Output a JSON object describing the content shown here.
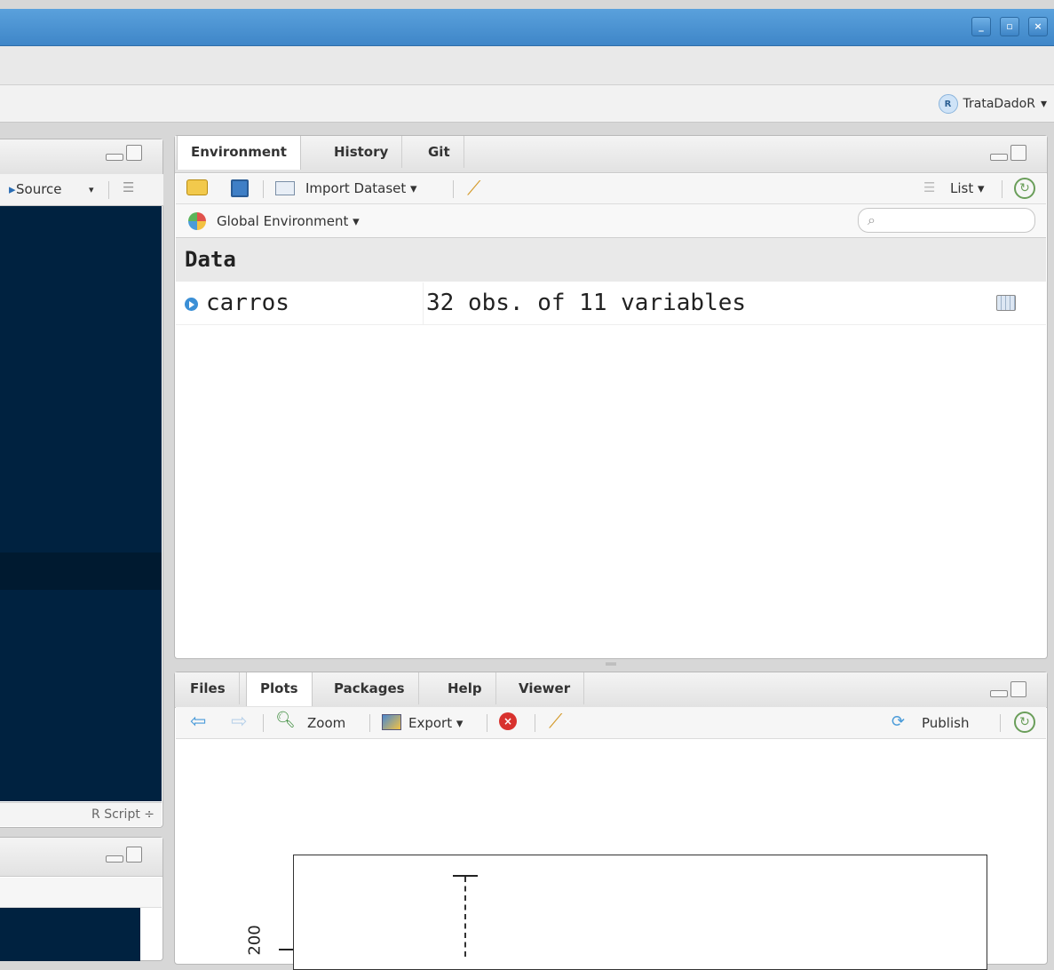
{
  "window": {
    "buttons": {
      "minimize": "_",
      "restore": "▫",
      "close": "×"
    }
  },
  "project": {
    "name": "TrataDadoR",
    "caret": "▾",
    "icon": "R"
  },
  "source_pane": {
    "toolbar": {
      "source_label": "Source",
      "caret": "▾"
    },
    "status": {
      "file_type": "R Script ÷"
    }
  },
  "env_pane": {
    "tabs": [
      "Environment",
      "History",
      "Git"
    ],
    "toolbar": {
      "import_label": "Import Dataset ▾",
      "view_mode": "List ▾"
    },
    "scope": {
      "label": "Global Environment ▾"
    },
    "search": {
      "placeholder": ""
    },
    "section_title": "Data",
    "rows": [
      {
        "name": "carros",
        "value": "32 obs. of 11 variables"
      }
    ]
  },
  "files_pane": {
    "tabs": [
      "Files",
      "Plots",
      "Packages",
      "Help",
      "Viewer"
    ],
    "toolbar": {
      "zoom_label": "Zoom",
      "export_label": "Export ▾",
      "publish_label": "Publish"
    },
    "plot": {
      "y_tick": "200"
    }
  },
  "colors": {
    "editor_bg": "#002240",
    "titlebar": "#4a94d4",
    "accent_blue": "#3b8fd6"
  }
}
